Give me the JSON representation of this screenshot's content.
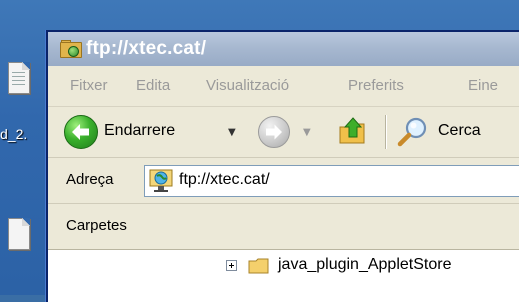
{
  "desktop": {
    "icon_label": "d_2."
  },
  "window": {
    "title": "ftp://xtec.cat/",
    "menu": [
      "Fitxer",
      "Edita",
      "Visualització",
      "Preferits",
      "Eine"
    ],
    "toolbar": {
      "back_label": "Endarrere",
      "search_label": "Cerca"
    },
    "address": {
      "label": "Adreça",
      "value": "ftp://xtec.cat/"
    },
    "panel": {
      "title": "Carpetes"
    },
    "tree": {
      "items": [
        {
          "label": "java_plugin_AppletStore"
        }
      ]
    }
  },
  "icons": {
    "title": "ftp-folder-icon",
    "back": "back-arrow-icon",
    "forward": "forward-arrow-icon",
    "up": "folder-up-icon",
    "search": "search-icon",
    "address": "ftp-location-icon",
    "tree_folder": "folder-icon"
  }
}
